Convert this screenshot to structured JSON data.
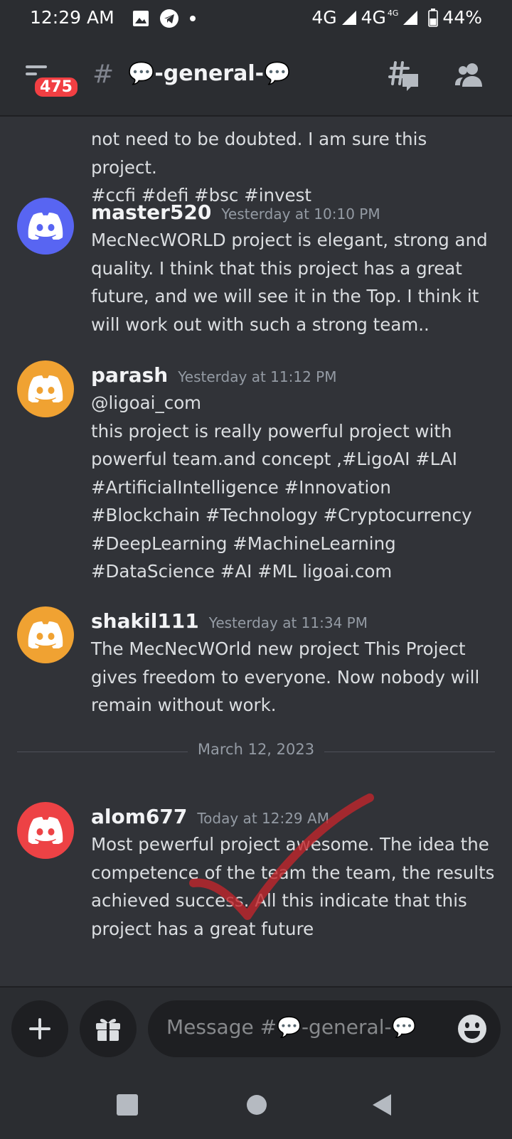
{
  "status_bar": {
    "time": "12:29 AM",
    "network_1": "4G",
    "network_2": "4G",
    "network_2_sub": "4G",
    "battery": "44%"
  },
  "header": {
    "unread_badge": "475",
    "channel_name": "💬-general-💬"
  },
  "messages": [
    {
      "continuation": true,
      "text": "not need to be doubted. I am sure this project.\n#ccfi #defi #bsc #invest"
    },
    {
      "username": "master520",
      "timestamp": "Yesterday at 10:10 PM",
      "avatar_color": "#5865f2",
      "text": "MecNecWORLD project is elegant, strong and quality. I think that this project has a great future, and we will see it in the Top. I think it will work out with such a strong team.."
    },
    {
      "username": "parash",
      "timestamp": "Yesterday at 11:12 PM",
      "avatar_color": "#f0a232",
      "text": "@ligoai_com\nthis project is really powerful project with powerful team.and concept ,#LigoAI #LAI #ArtificialIntelligence #Innovation #Blockchain #Technology #Cryptocurrency #DeepLearning #MachineLearning #DataScience #AI #ML ligoai.com"
    },
    {
      "username": "shakil111",
      "timestamp": "Yesterday at 11:34 PM",
      "avatar_color": "#f0a232",
      "text": "The MecNecWOrld new project This Project gives freedom to everyone. Now nobody will remain without work."
    },
    {
      "username": "alom677",
      "timestamp": "Today at 12:29 AM",
      "avatar_color": "#ed4245",
      "text": "Most pewerful project awesome. The idea the competence of the team the team, the results achieved success. All this indicate that this project has a great future"
    }
  ],
  "date_divider": "March 12, 2023",
  "composer": {
    "placeholder": "Message #💬-general-💬"
  },
  "colors": {
    "background": "#313338",
    "header_bg": "#2b2d31",
    "badge": "#f23f43",
    "annotation_check": "#c0262c"
  }
}
